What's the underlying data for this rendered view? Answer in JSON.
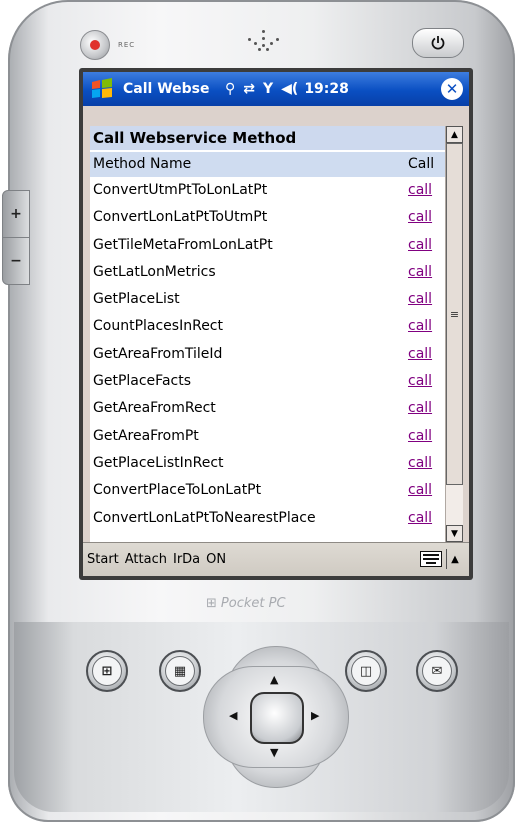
{
  "device": {
    "rec_label": "REC",
    "brand_label": "Pocket PC"
  },
  "titlebar": {
    "title": "Call Webse",
    "time": "19:28",
    "icons": [
      "windows-start-icon",
      "connectivity-icon",
      "sync-arrows-icon",
      "signal-strength-icon",
      "speaker-volume-icon",
      "close-icon"
    ]
  },
  "table": {
    "title": "Call Webservice Method",
    "headers": {
      "method": "Method Name",
      "call": "Call"
    },
    "rows": [
      {
        "name": "ConvertUtmPtToLonLatPt",
        "action": "call"
      },
      {
        "name": "ConvertLonLatPtToUtmPt",
        "action": "call"
      },
      {
        "name": "GetTileMetaFromLonLatPt",
        "action": "call"
      },
      {
        "name": "GetLatLonMetrics",
        "action": "call"
      },
      {
        "name": "GetPlaceList",
        "action": "call"
      },
      {
        "name": "CountPlacesInRect",
        "action": "call"
      },
      {
        "name": "GetAreaFromTileId",
        "action": "call"
      },
      {
        "name": "GetPlaceFacts",
        "action": "call"
      },
      {
        "name": "GetAreaFromRect",
        "action": "call"
      },
      {
        "name": "GetAreaFromPt",
        "action": "call"
      },
      {
        "name": "GetPlaceListInRect",
        "action": "call"
      },
      {
        "name": "ConvertPlaceToLonLatPt",
        "action": "call"
      },
      {
        "name": "ConvertLonLatPtToNearestPlace",
        "action": "call"
      }
    ]
  },
  "menubar": {
    "items": [
      "Start",
      "Attach",
      "IrDa",
      "ON"
    ]
  },
  "colors": {
    "titlebar": "#0a4fc2",
    "link_visited": "#800080",
    "table_header": "#cfdcf0"
  }
}
